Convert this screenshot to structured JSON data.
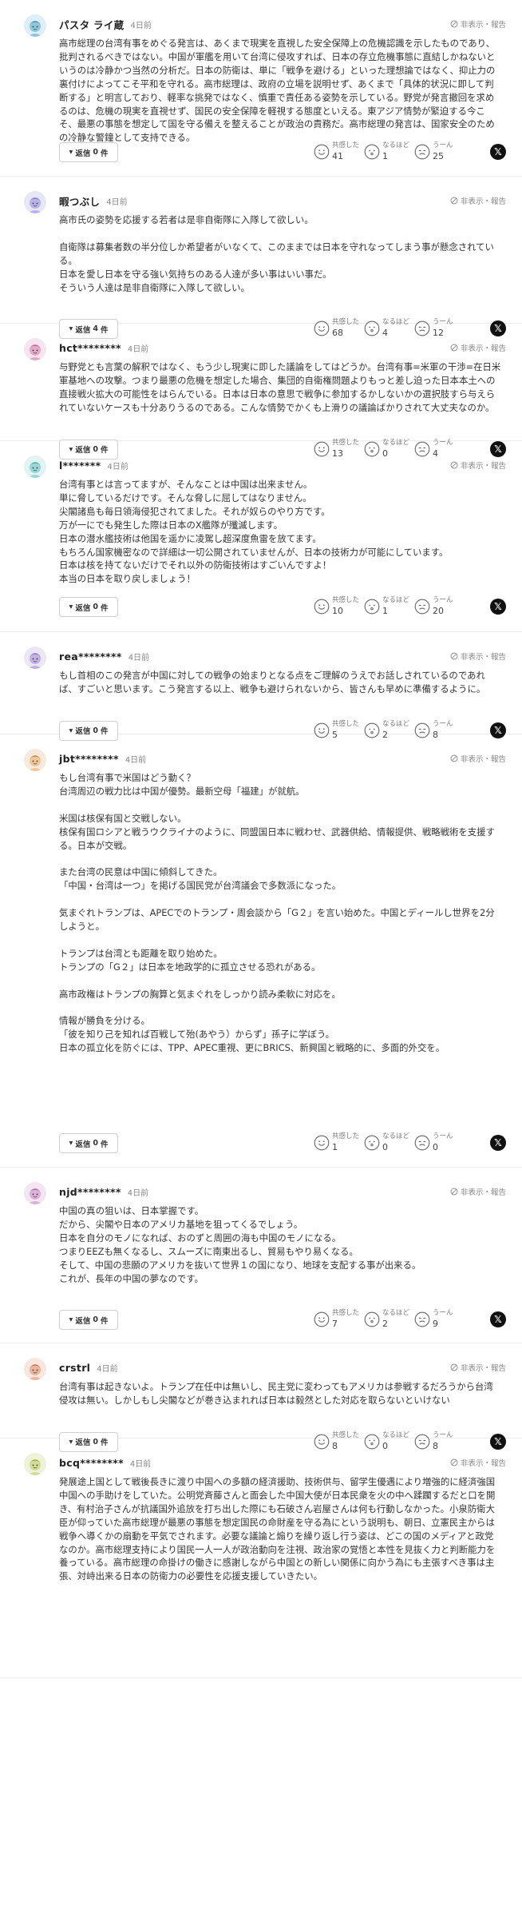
{
  "ui": {
    "report_label": "非表示・報告",
    "reply_prefix": "返信",
    "reply_suffix": "件",
    "reaction_labels": [
      "共感した",
      "なるほど",
      "うーん"
    ]
  },
  "comments": [
    {
      "user": "パスタ ライ蔵",
      "time": "4日前",
      "avatar": "face-a",
      "text": "高市総理の台湾有事をめぐる発言は、あくまで現実を直視した安全保障上の危機認識を示したものであり、批判されるべきではない。中国が軍艦を用いて台湾に侵攻すれば、日本の存立危機事態に直結しかねないというのは冷静かつ当然の分析だ。日本の防衛は、単に「戦争を避ける」といった理想論ではなく、抑止力の裏付けによってこそ平和を守れる。高市総理は、政府の立場を説明せず、あくまで「具体的状況に即して判断する」と明言しており、軽率な挑発ではなく、慎重で責任ある姿勢を示している。野党が発言撤回を求めるのは、危機の現実を直視せず、国民の安全保障を軽視する態度といえる。東アジア情勢が緊迫する今こそ、最悪の事態を想定して国を守る備えを整えることが政治の責務だ。高市総理の発言は、国家安全のための冷静な警鐘として支持できる。",
      "replies": "0",
      "reactions": [
        "41",
        "1",
        "25"
      ]
    },
    {
      "user": "暇つぶし",
      "time": "4日前",
      "avatar": "face-b",
      "text": "高市氏の姿勢を応援する若者は是非自衛隊に入隊して欲しい。\n\n自衛隊は募集者数の半分位しか希望者がいなくて、このままでは日本を守れなってしまう事が懸念されている。\n日本を愛し日本を守る強い気持ちのある人達が多い事はいい事だ。\nそういう人達は是非自衛隊に入隊して欲しい。",
      "replies": "4",
      "reactions": [
        "68",
        "4",
        "12"
      ]
    },
    {
      "user": "hct********",
      "time": "4日前",
      "avatar": "face-c",
      "text": "与野党とも言葉の解釈ではなく、もう少し現実に即した議論をしてはどうか。台湾有事=米軍の干渉=在日米軍基地への攻撃。つまり最悪の危機を想定した場合、集団的自衛権問題よりもっと差し迫った日本本土への直接戦火拡大の可能性をはらんでいる。日本は日本の意思で戦争に参加するかしないかの選択肢すら与えられていないケースも十分ありうるのである。こんな情勢でかくも上滑りの議論ばかりされて大丈夫なのか。",
      "replies": "0",
      "reactions": [
        "13",
        "0",
        "4"
      ]
    },
    {
      "user": "l*******",
      "time": "4日前",
      "avatar": "face-d",
      "text": "台湾有事とは言ってますが、そんなことは中国は出来ません。\n単に脅しているだけです。そんな脅しに屈してはなりません。\n尖閣諸島も毎日領海侵犯されてました。それが奴らのやり方です。\n万が一にでも発生した際は日本のX艦隊が殲滅します。\n日本の潜水艦技術は他国を遥かに凌駕し超深度魚雷を放てます。\nもちろん国家機密なので詳細は一切公開されていませんが、日本の技術力が可能にしています。\n日本は核を持てないだけでそれ以外の防衛技術はすごいんですよ！\n本当の日本を取り戻しましょう！",
      "replies": "0",
      "reactions": [
        "10",
        "1",
        "20"
      ]
    },
    {
      "user": "rea********",
      "time": "4日前",
      "avatar": "face-e",
      "text": "もし首相のこの発言が中国に対しての戦争の始まりとなる点をご理解のうえでお話しされているのであれば、すごいと思います。こう発言する以上、戦争も避けられないから、皆さんも早めに準備するように。",
      "replies": "0",
      "reactions": [
        "5",
        "2",
        "8"
      ]
    },
    {
      "user": "jbt********",
      "time": "4日前",
      "avatar": "face-f",
      "text": "もし台湾有事で米国はどう動く？\n台湾周辺の戦力比は中国が優勢。最新空母「福建」が就航。\n\n米国は核保有国と交戦しない。\n核保有国ロシアと戦うウクライナのように、同盟国日本に戦わせ、武器供給、情報提供、戦略戦術を支援する。日本が交戦。\n\nまた台湾の民意は中国に傾斜してきた。\n「中国・台湾は一つ」を掲げる国民党が台湾議会で多数派になった。\n\n気まぐれトランプは、APECでのトランプ・周会談から「G２」を言い始めた。中国とディールし世界を2分しようと。\n\nトランプは台湾とも距離を取り始めた。\nトランプの「G２」は日本を地政学的に孤立させる恐れがある。\n\n高市政権はトランプの胸算と気まぐれをしっかり読み柔軟に対応を。\n\n情報が勝負を分ける。\n「彼を知り己を知れば百戦して殆(あやう）からず」孫子に学ぼう。\n日本の孤立化を防ぐには、TPP、APEC重視、更にBRICS、新興国と戦略的に、多面的外交を。",
      "replies": "0",
      "reactions": [
        "1",
        "0",
        "0"
      ]
    },
    {
      "user": "njd********",
      "time": "4日前",
      "avatar": "face-g",
      "text": "中国の真の狙いは、日本掌握です。\nだから、尖閣や日本のアメリカ基地を狙ってくるでしょう。\n日本を自分のモノになれば、おのずと周囲の海も中国のモノになる。\nつまりEEZも無くなるし、スムーズに南東出るし、貿易もやり易くなる。\nそして、中国の悲願のアメリカを抜いて世界１の国になり、地球を支配する事が出来る。\nこれが、長年の中国の夢なのです。",
      "replies": "0",
      "reactions": [
        "7",
        "2",
        "9"
      ]
    },
    {
      "user": "crstrl",
      "time": "4日前",
      "avatar": "face-h",
      "text": "台湾有事は起きないよ。トランプ在任中は無いし、民主党に変わってもアメリカは参戦するだろうから台湾侵攻は無い。しかしもし尖閣などが巻き込まれれば日本は毅然とした対応を取らないといけない",
      "replies": "0",
      "reactions": [
        "8",
        "0",
        "8"
      ]
    },
    {
      "user": "bcq********",
      "time": "4日前",
      "avatar": "face-i",
      "text": "発展途上国として戦後長きに渡り中国への多額の経済援助、技術供与、留学生優遇により増強的に経済強国中国への手助けをしていた。公明党斉藤さんと面会した中国大使が日本民衆を火の中へ蹂躙するだと口を開き、有村治子さんが抗議国外追放を打ち出した際にも石破さん岩屋さんは何も行動しなかった。小泉防衛大臣が仰っていた高市総理が最悪の事態を想定国民の命財産を守る為にという説明も、朝日、立憲民主からは戦争へ導くかの扇動を平気でされます。必要な議論と煽りを繰り返し行う姿は、どこの国のメディアと政党なのか。高市総理支持により国民一人一人が政治動向を注視、政治家の覚悟と本性を見抜く力と判断能力を養っている。高市総理の命掛けの働きに感謝しながら中国との新しい関係に向かう為にも主張すべき事は主張、対峙出来る日本の防衛力の必要性を応援支援していきたい。",
      "replies": "",
      "reactions": []
    }
  ]
}
